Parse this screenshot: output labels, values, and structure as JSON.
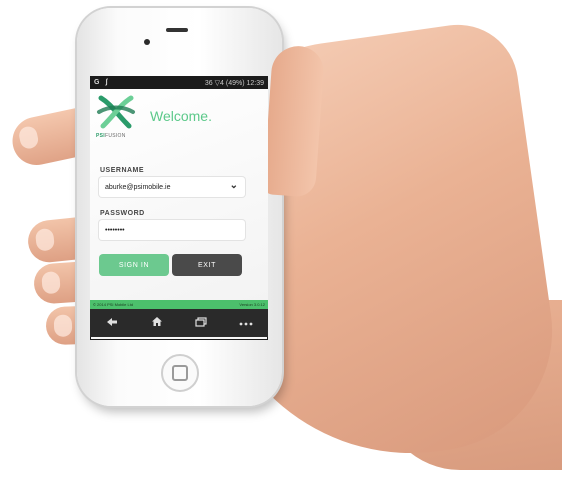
{
  "status_bar": {
    "left_icons": [
      "G",
      "ʃ"
    ],
    "right_text": "36 ▽4 (49%) 12:39",
    "time": "12:39"
  },
  "brand": {
    "name_strong": "PSI",
    "name_rest": "FUSION",
    "welcome": "Welcome."
  },
  "form": {
    "username_label": "USERNAME",
    "username_value": "aburke@psimobile.ie",
    "password_label": "PASSWORD",
    "password_value": "••••••••"
  },
  "buttons": {
    "sign_in": "SIGN IN",
    "exit": "EXIT"
  },
  "footer": {
    "copyright": "© 2014 PSI Mobile Ltd",
    "version": "Version 3.0.12"
  },
  "nav": {
    "back_icon": "back-arrow-icon",
    "home_icon": "home-icon",
    "windows_icon": "recent-apps-icon",
    "more_icon": "more-dots-icon"
  },
  "colors": {
    "brand_green": "#5cc98a",
    "exit_gray": "#4a4a4a",
    "footer_green": "#4cc06c"
  }
}
